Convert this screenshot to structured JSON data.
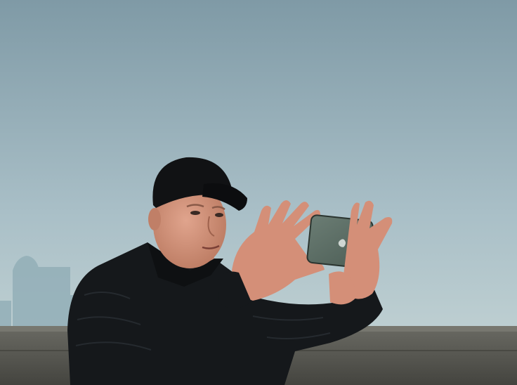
{
  "scene": {
    "description_free": true,
    "colors": {
      "sky_top": "#7f9aa6",
      "sky_mid": "#a9bfc7",
      "sky_bottom": "#c7d6d6",
      "skyline": "#93afb8",
      "wall": "#54544f",
      "jacket": "#15181b",
      "cap": "#111214",
      "skin": "#d79a83",
      "phone": "#5e7067"
    },
    "icons": {
      "phone_logo": "apple-logo-icon"
    }
  }
}
